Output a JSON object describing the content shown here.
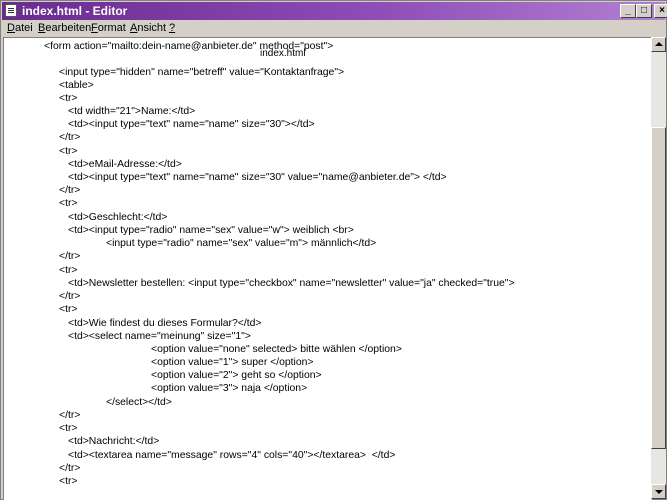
{
  "window": {
    "title": "index.html - Editor",
    "controls": {
      "minimize": "_",
      "maximize": "□",
      "close": "×"
    }
  },
  "menubar": {
    "items": [
      {
        "label": "Datei",
        "mnemonic_index": 0
      },
      {
        "label": "Bearbeiten",
        "mnemonic_index": 0
      },
      {
        "label": "Format",
        "mnemonic_index": 0
      },
      {
        "label": "Ansicht",
        "mnemonic_index": 0
      },
      {
        "label": "?",
        "mnemonic_index": 0
      }
    ]
  },
  "editor": {
    "tooltip": "index.html",
    "lines": [
      "<form action=\"mailto:dein-name@anbieter.de\" method=\"post\">",
      "",
      "<input type=\"hidden\" name=\"betreff\" value=\"Kontaktanfrage\">",
      "<table>",
      "<tr>",
      "<td width=\"21\">Name:</td>",
      "<td><input type=\"text\" name=\"name\" size=\"30\"></td>",
      "</tr>",
      "<tr>",
      "<td>eMail-Adresse:</td>",
      "<td><input type=\"text\" name=\"name\" size=\"30\" value=\"name@anbieter.de\"> </td>",
      "</tr>",
      "<tr>",
      "<td>Geschlecht:</td>",
      "<td><input type=\"radio\" name=\"sex\" value=\"w\"> weiblich <br>",
      "<input type=\"radio\" name=\"sex\" value=\"m\"> männlich</td>",
      "</tr>",
      "<tr>",
      "<td>Newsletter bestellen: <input type=\"checkbox\" name=\"newsletter\" value=\"ja\" checked=\"true\">",
      "</tr>",
      "<tr>",
      "<td>Wie findest du dieses Formular?</td>",
      "<td><select name=\"meinung\" size=\"1\">",
      "<option value=\"none\" selected> bitte wählen </option>",
      "<option value=\"1\"> super </option>",
      "<option value=\"2\"> geht so </option>",
      "<option value=\"3\"> naja </option>",
      "</select></td>",
      "</tr>",
      "<tr>",
      "<td>Nachricht:</td>",
      "<td><textarea name=\"message\" rows=\"4\" cols=\"40\"></textarea>  </td>",
      "</tr>",
      "<tr>"
    ]
  },
  "colors": {
    "titlebar_start": "#6a2a8e",
    "titlebar_end": "#b27fd2",
    "chrome": "#d4d0c8",
    "editor_bg": "#ffffff"
  }
}
